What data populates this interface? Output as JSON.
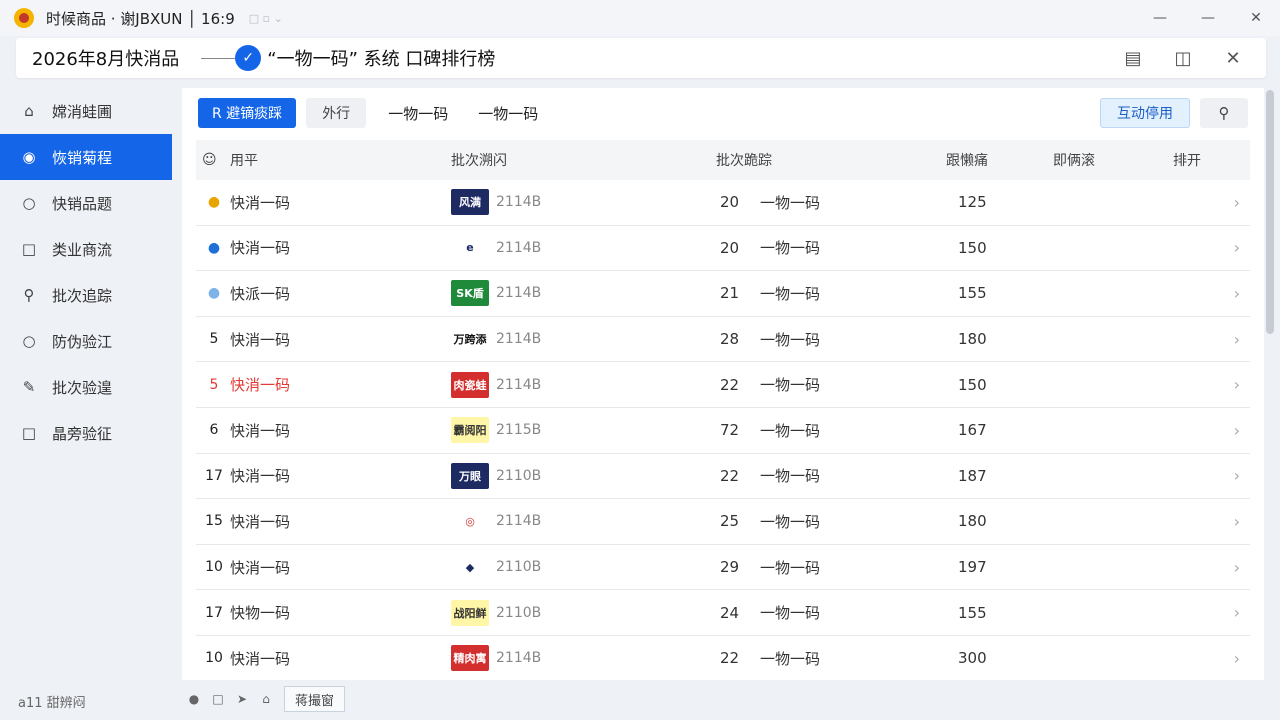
{
  "titlebar": {
    "text": "时候商品 · 谢JBXUN │ 16:9",
    "extra": "□ ▫ ⌄"
  },
  "header": {
    "title": "2026年8月快消品",
    "subtitle": "“一物一码” 系统 口碑排行榜"
  },
  "sidebar": {
    "items": [
      {
        "label": "嫦消蛙圃",
        "icon": "home-icon"
      },
      {
        "label": "恢销菊程",
        "icon": "eye-icon"
      },
      {
        "label": "快销品题",
        "icon": "circle-icon"
      },
      {
        "label": "类业商流",
        "icon": "square-icon"
      },
      {
        "label": "批次追踪",
        "icon": "location-icon"
      },
      {
        "label": "防伪验江",
        "icon": "circle-icon"
      },
      {
        "label": "批次验遑",
        "icon": "lock-icon"
      },
      {
        "label": "晶旁验征",
        "icon": "square-icon"
      }
    ]
  },
  "toolbar": {
    "primary_label": "R 避镝痰踩",
    "secondary_label": "外行",
    "tabs": [
      "一物一码",
      "一物一码"
    ],
    "right_button": "互动停用"
  },
  "table": {
    "headers": [
      "用平",
      "批次溯闪",
      "批次跪踪",
      "跟懒痛",
      "即俩滚",
      "排开"
    ],
    "rows": [
      {
        "rank": "",
        "name": "快消一码",
        "logo": "风满",
        "code": "2114B",
        "batch": "20",
        "item": "一物一码",
        "score": "125",
        "rankColor": "#e8a400",
        "logoBg": "#1e2b63",
        "logoColor": "#ffffff"
      },
      {
        "rank": "",
        "name": "快消一码",
        "logo": "e",
        "code": "2114B",
        "batch": "20",
        "item": "一物一码",
        "score": "150",
        "rankColor": "#1e6fd6",
        "logoBg": "#ffffff",
        "logoColor": "#1e2b63"
      },
      {
        "rank": "",
        "name": "快派一码",
        "logo": "SK盾",
        "code": "2114B",
        "batch": "21",
        "item": "一物一码",
        "score": "155",
        "rankColor": "#7fb3e8",
        "logoBg": "#1f8a3a",
        "logoColor": "#ffffff"
      },
      {
        "rank": "5",
        "name": "快消一码",
        "logo": "万跨添",
        "code": "2114B",
        "batch": "28",
        "item": "一物一码",
        "score": "180",
        "rankColor": "#222222",
        "logoBg": "#ffffff",
        "logoColor": "#111111"
      },
      {
        "rank": "5",
        "name": "快消一码",
        "logo": "肉瓷蛙",
        "code": "2114B",
        "batch": "22",
        "item": "一物一码",
        "score": "150",
        "rankColor": "#e53935",
        "logoBg": "#d32f2f",
        "logoColor": "#ffffff"
      },
      {
        "rank": "6",
        "name": "快消一码",
        "logo": "霸阅阳",
        "code": "2115B",
        "batch": "72",
        "item": "一物一码",
        "score": "167",
        "rankColor": "#222222",
        "logoBg": "#fff6a8",
        "logoColor": "#333333"
      },
      {
        "rank": "17",
        "name": "快消一码",
        "logo": "万眼",
        "code": "2110B",
        "batch": "22",
        "item": "一物一码",
        "score": "187",
        "rankColor": "#222222",
        "logoBg": "#1e2b63",
        "logoColor": "#ffffff"
      },
      {
        "rank": "15",
        "name": "快消一码",
        "logo": "◎",
        "code": "2114B",
        "batch": "25",
        "item": "一物一码",
        "score": "180",
        "rankColor": "#222222",
        "logoBg": "#ffffff",
        "logoColor": "#d32f2f"
      },
      {
        "rank": "10",
        "name": "快消一码",
        "logo": "◆",
        "code": "2110B",
        "batch": "29",
        "item": "一物一码",
        "score": "197",
        "rankColor": "#222222",
        "logoBg": "#ffffff",
        "logoColor": "#1e2b63"
      },
      {
        "rank": "17",
        "name": "快物一码",
        "logo": "战阳鲜",
        "code": "2110B",
        "batch": "24",
        "item": "一物一码",
        "score": "155",
        "rankColor": "#222222",
        "logoBg": "#fff6a8",
        "logoColor": "#333333"
      },
      {
        "rank": "10",
        "name": "快消一码",
        "logo": "精肉寓",
        "code": "2114B",
        "batch": "22",
        "item": "一物一码",
        "score": "300",
        "rankColor": "#222222",
        "logoBg": "#d32f2f",
        "logoColor": "#ffffff"
      }
    ]
  },
  "statusbar": {
    "left": "a11  甜辨闷",
    "tag": "蒋撮窗"
  },
  "colors": {
    "accent": "#1565e8",
    "row_highlight_name": "#e53935"
  }
}
